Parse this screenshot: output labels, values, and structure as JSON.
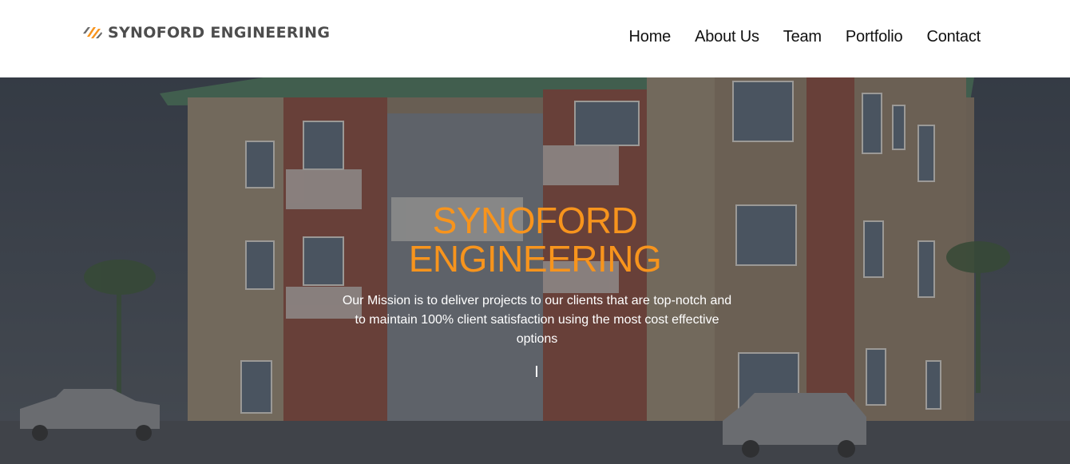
{
  "header": {
    "logo_text": "SYNOFORD ENGINEERING",
    "logo_icon": "stripes-logo-icon",
    "nav": [
      "Home",
      "About Us",
      "Team",
      "Portfolio",
      "Contact"
    ]
  },
  "hero": {
    "title_line1": "SYNOFORD",
    "title_line2": "ENGINEERING",
    "mission": "Our Mission is to deliver projects to our clients that are top-notch and to maintain 100% client satisfaction using the most cost effective options",
    "background": "apartment-building-photo"
  },
  "colors": {
    "accent": "#f7941d",
    "logo_text": "#4d4d4d",
    "nav_text": "#111111",
    "hero_text": "#ffffff"
  }
}
